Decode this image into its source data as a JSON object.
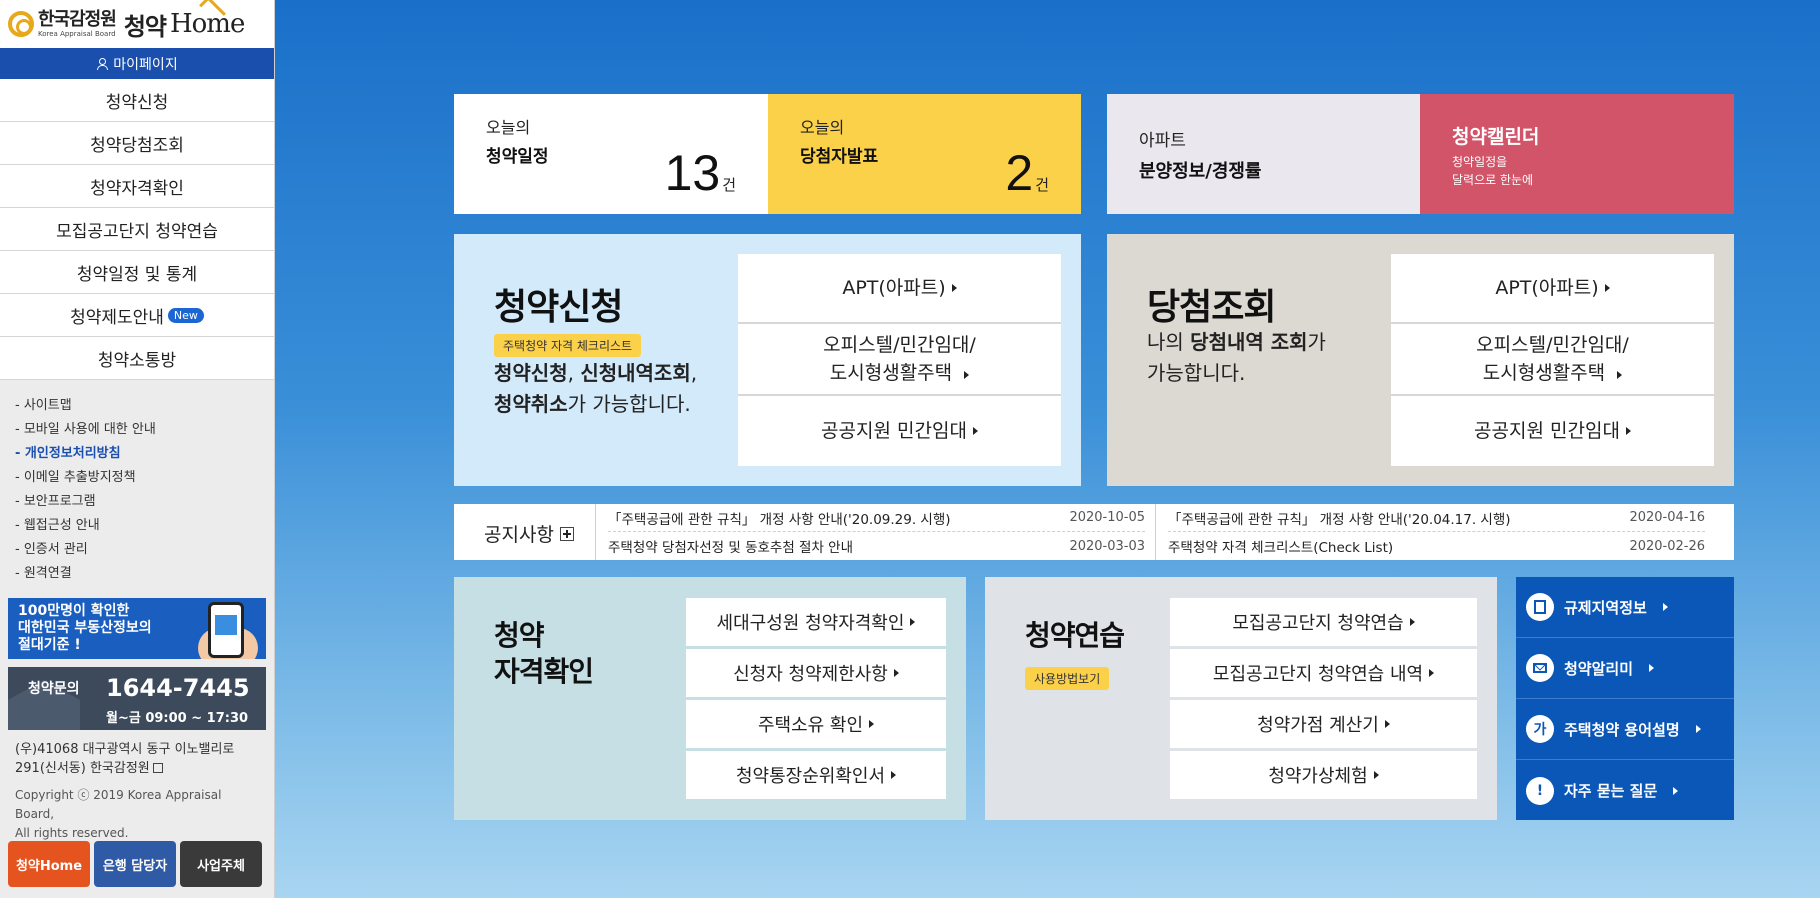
{
  "logo": {
    "org_kr": "한국감정원",
    "org_en": "Korea Appraisal Board",
    "service": "청약",
    "home": "Home"
  },
  "sidebar": {
    "mypage_label": "마이페이지",
    "nav": [
      "청약신청",
      "청약당첨조회",
      "청약자격확인",
      "모집공고단지 청약연습",
      "청약일정 및 통계",
      "청약제도안내",
      "청약소통방"
    ],
    "new_badge": "New",
    "links": [
      "- 사이트맵",
      "- 모바일 사용에 대한 안내",
      "- 개인정보처리방침",
      "- 이메일 추출방지정책",
      "- 보안프로그램",
      "- 웹접근성 안내",
      "- 인증서 관리",
      "- 원격연결"
    ],
    "banner_text": [
      "100만명이 확인한",
      "대한민국 부동산정보의",
      "절대기준 !"
    ],
    "inquiry": {
      "label": "청약문의",
      "phone": "1644-7445",
      "hours": "월~금 09:00 ~ 17:30"
    },
    "address": [
      "(우)41068 대구광역시 동구 이노밸리로",
      "291(신서동) 한국감정원"
    ],
    "copyright": [
      "Copyright ⓒ 2019 Korea Appraisal Board,",
      "All rights reserved."
    ],
    "bottom_buttons": [
      "청약Home",
      "은행 담당자",
      "사업주체"
    ]
  },
  "stats": {
    "schedule": {
      "line1": "오늘의",
      "line2": "청약일정",
      "count": "13",
      "unit": "건"
    },
    "winners": {
      "line1": "오늘의",
      "line2": "당첨자발표",
      "count": "2",
      "unit": "건"
    }
  },
  "apt_info": {
    "line1": "아파트",
    "line2": "분양정보/경쟁률"
  },
  "calendar": {
    "title": "청약캘린더",
    "desc": [
      "청약일정을",
      "달력으로 한눈에"
    ]
  },
  "apply": {
    "title": "청약신청",
    "tag": "주택청약 자격 체크리스트",
    "desc_b1": "청약신청",
    "desc_t1": ", ",
    "desc_b2": "신청내역조회",
    "desc_t2": ",",
    "desc_b3": "청약취소",
    "desc_t3": "가 가능합니다.",
    "buttons": [
      "APT(아파트)",
      "오피스텔/민간임대/",
      "도시형생활주택",
      "공공지원 민간임대"
    ]
  },
  "result": {
    "title": "당첨조회",
    "desc_t1": "나의 ",
    "desc_b1": "당첨내역 조회",
    "desc_t2": "가",
    "desc_t3": "가능합니다.",
    "buttons": [
      "APT(아파트)",
      "오피스텔/민간임대/",
      "도시형생활주택",
      "공공지원 민간임대"
    ]
  },
  "notice": {
    "title": "공지사항",
    "items": [
      {
        "title": "「주택공급에 관한 규칙」 개정 사항 안내('20.09.29. 시행)",
        "date": "2020-10-05"
      },
      {
        "title": "주택청약 당첨자선정 및 동호추첨 절차 안내",
        "date": "2020-03-03"
      },
      {
        "title": "「주택공급에 관한 규칙」 개정 사항 안내('20.04.17. 시행)",
        "date": "2020-04-16"
      },
      {
        "title": "주택청약 자격 체크리스트(Check List)",
        "date": "2020-02-26"
      }
    ]
  },
  "eligibility": {
    "title_l1": "청약",
    "title_l2": "자격확인",
    "buttons": [
      "세대구성원 청약자격확인",
      "신청자 청약제한사항",
      "주택소유 확인",
      "청약통장순위확인서"
    ]
  },
  "practice": {
    "title": "청약연습",
    "tag": "사용방법보기",
    "buttons": [
      "모집공고단지 청약연습",
      "모집공고단지 청약연습 내역",
      "청약가점 계산기",
      "청약가상체험"
    ]
  },
  "quicklinks": [
    {
      "label": "규제지역정보",
      "icon": "building-icon"
    },
    {
      "label": "청약알리미",
      "icon": "mail-icon"
    },
    {
      "label": "주택청약 용어설명",
      "icon": "glossary-icon",
      "glyph": "가"
    },
    {
      "label": "자주 묻는 질문",
      "icon": "exclamation-icon",
      "glyph": "!"
    }
  ],
  "colors": {
    "sidebar_blue": "#1b4fae",
    "yellow": "#fcd14a",
    "calendar_red": "#d25468",
    "quick_blue": "#0b57b8"
  }
}
